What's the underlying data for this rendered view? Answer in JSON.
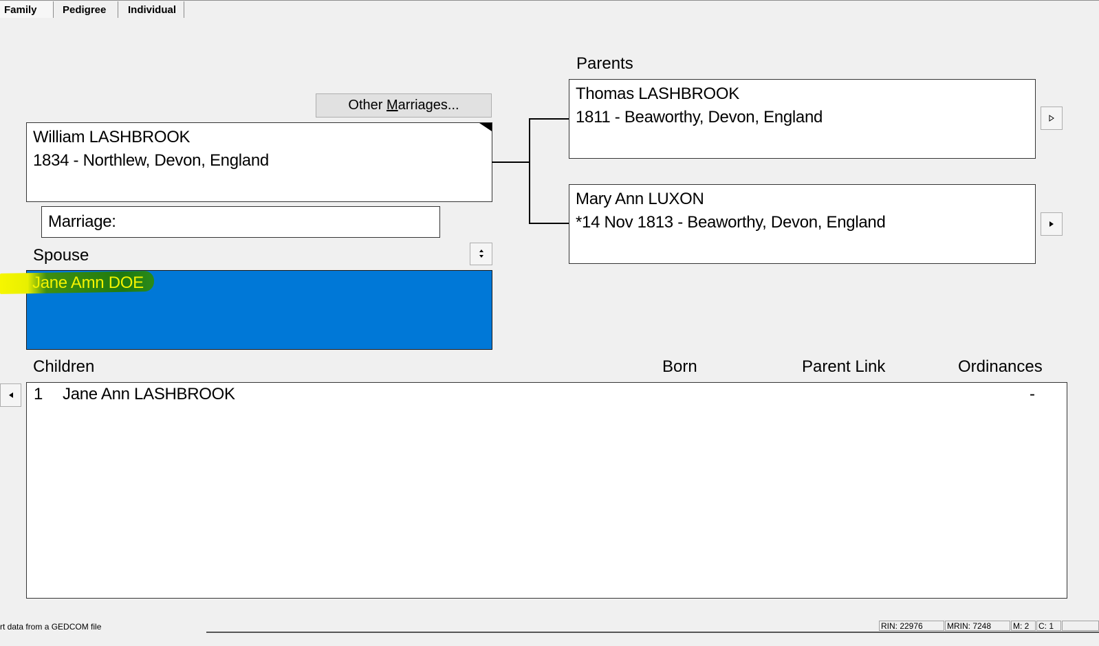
{
  "tabs": [
    "Family",
    "Pedigree",
    "Individual"
  ],
  "primary": {
    "name": "William LASHBROOK",
    "detail": "1834 - Northlew, Devon, England"
  },
  "other_marriages": {
    "pre": "Other ",
    "mnemonic": "M",
    "post": "arriages..."
  },
  "marriage": {
    "label": "Marriage:"
  },
  "spouse": {
    "label": "Spouse",
    "name": "Jane Amn DOE",
    "switch_icon": "updown-arrows-icon"
  },
  "parents": {
    "label": "Parents",
    "father": {
      "name": "Thomas LASHBROOK",
      "detail": "1811 - Beaworthy, Devon, England"
    },
    "mother": {
      "name": "Mary Ann LUXON",
      "detail": "*14 Nov 1813 - Beaworthy, Devon, England"
    },
    "nav_icon": "triangle-right-icon"
  },
  "children": {
    "label": "Children",
    "columns": {
      "born": "Born",
      "parent_link": "Parent Link",
      "ordinances": "Ordinances"
    },
    "rows": [
      {
        "num": "1",
        "name": "Jane Ann LASHBROOK",
        "born": "",
        "parent_link": "",
        "ordinances": "-"
      }
    ],
    "nav_icon": "triangle-left-icon"
  },
  "statusbar": {
    "message": "rt data from a GEDCOM file",
    "rin": "RIN: 22976",
    "mrin": "MRIN: 7248",
    "m": "M: 2",
    "c": "C: 1"
  },
  "colors": {
    "spouse_selected_bg": "#0078d7",
    "spouse_text": "#f4f400",
    "highlight_yellow": "#f6f600",
    "highlight_green": "#1f7a10",
    "window_bg": "#f0f0f0"
  }
}
